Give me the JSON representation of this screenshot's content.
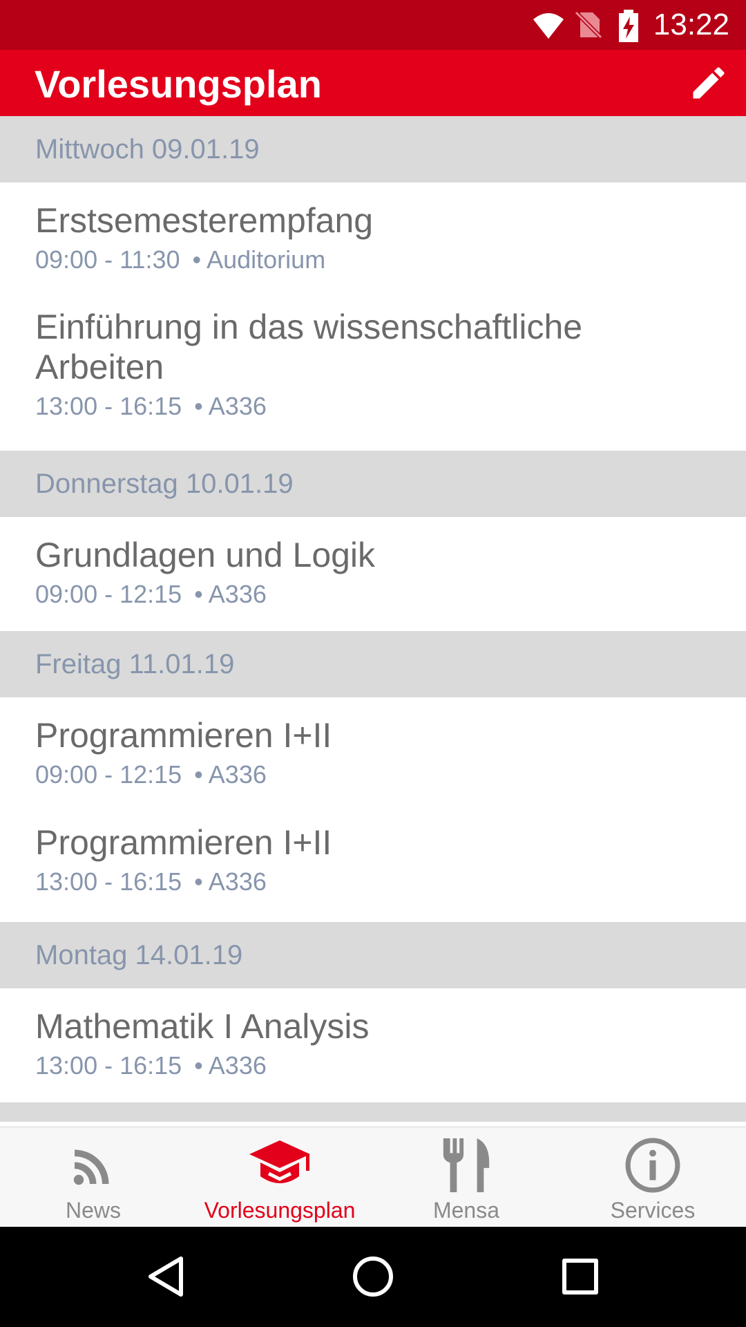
{
  "status_bar": {
    "time": "13:22",
    "icons": [
      "wifi-icon",
      "no-sim-icon",
      "battery-charging-icon"
    ],
    "color": "#b50015"
  },
  "app_bar": {
    "title": "Vorlesungsplan",
    "action_icon": "edit-pencil-icon",
    "color": "#e2001a"
  },
  "schedule": [
    {
      "day": "Mittwoch 09.01.19",
      "events": [
        {
          "title": "Erstsemesterempfang",
          "time": "09:00 - 11:30",
          "room": "Auditorium"
        },
        {
          "title": "Einführung in das wissenschaftliche Arbeiten",
          "time": "13:00 - 16:15",
          "room": "A336"
        }
      ]
    },
    {
      "day": "Donnerstag 10.01.19",
      "events": [
        {
          "title": "Grundlagen und Logik",
          "time": "09:00 - 12:15",
          "room": "A336"
        }
      ]
    },
    {
      "day": "Freitag 11.01.19",
      "events": [
        {
          "title": "Programmieren I+II",
          "time": "09:00 - 12:15",
          "room": "A336"
        },
        {
          "title": "Programmieren I+II",
          "time": "13:00 - 16:15",
          "room": "A336"
        }
      ]
    },
    {
      "day": "Montag 14.01.19",
      "events": [
        {
          "title": "Mathematik I Analysis",
          "time": "13:00 - 16:15",
          "room": "A336"
        }
      ]
    }
  ],
  "meta_separator": "•",
  "bottom_nav": [
    {
      "label": "News",
      "icon": "rss-feed-icon",
      "active": false
    },
    {
      "label": "Vorlesungsplan",
      "icon": "graduation-cap-icon",
      "active": true
    },
    {
      "label": "Mensa",
      "icon": "fork-knife-icon",
      "active": false
    },
    {
      "label": "Services",
      "icon": "info-circle-icon",
      "active": false
    }
  ],
  "system_nav": [
    "back-icon",
    "home-icon",
    "recents-icon"
  ],
  "colors": {
    "accent": "#e2001a",
    "muted_text": "#8795ac",
    "day_header_bg": "#dadada",
    "nav_inactive": "#8a8a8a"
  }
}
